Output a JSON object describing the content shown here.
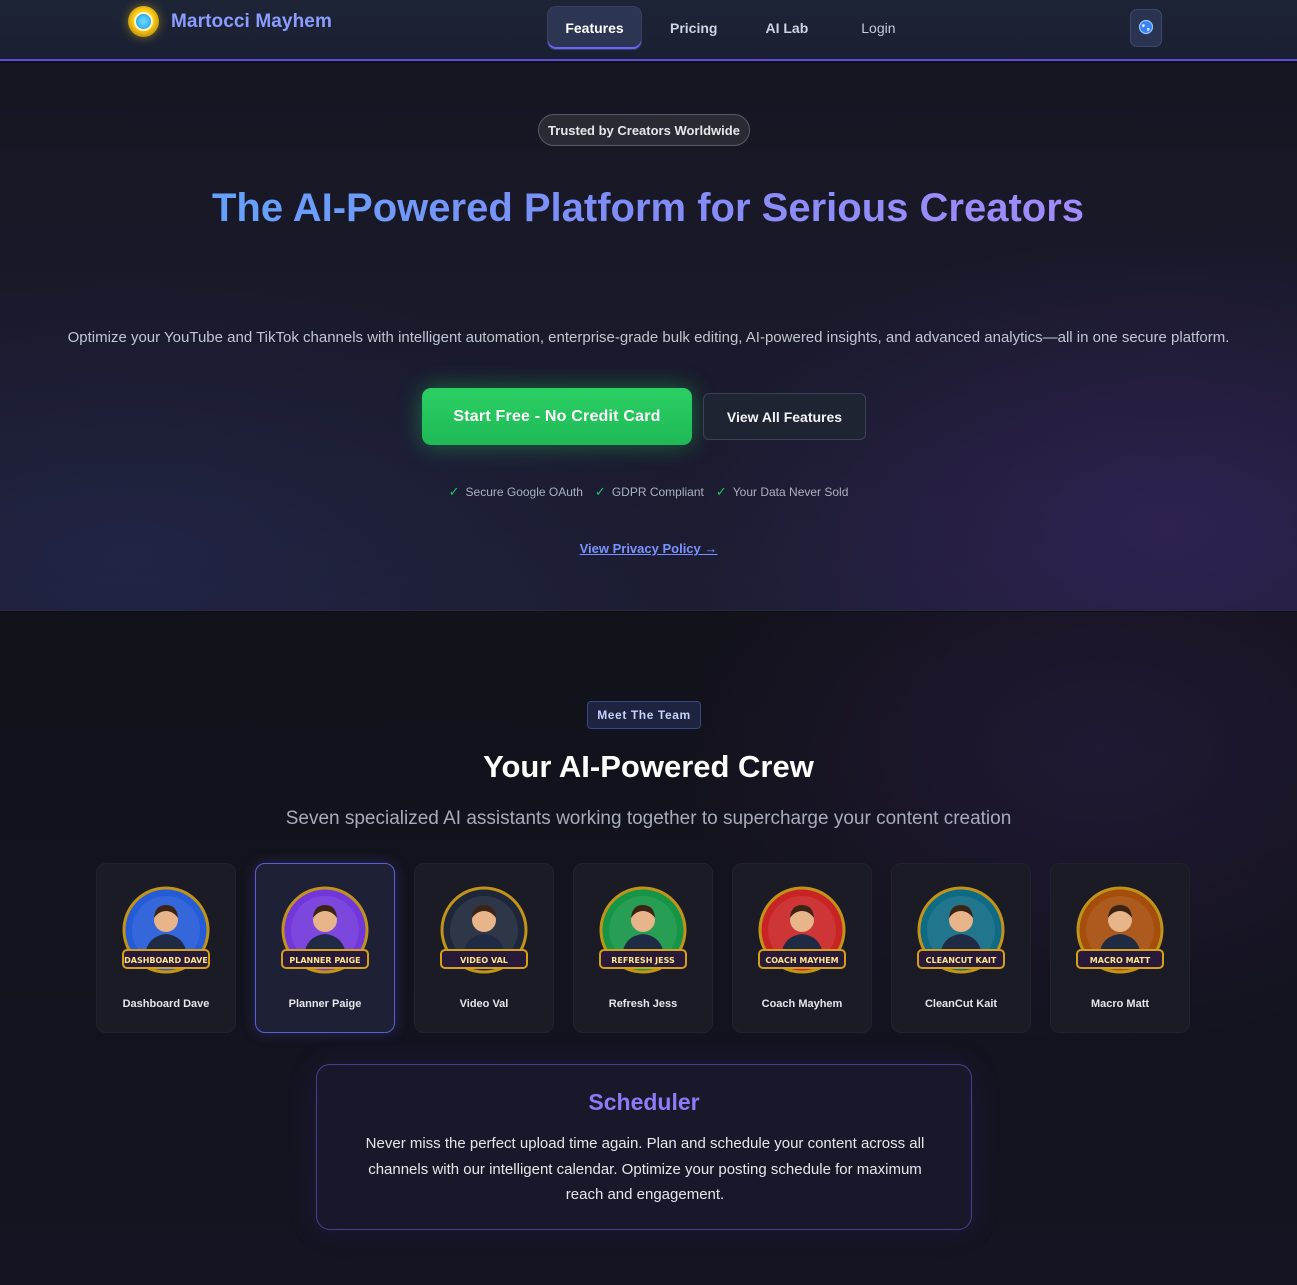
{
  "brand": {
    "name": "Martocci Mayhem",
    "logo_icon": "globe-coin-logo"
  },
  "nav": {
    "links": [
      {
        "label": "Features",
        "active": true
      },
      {
        "label": "Pricing"
      },
      {
        "label": "AI Lab"
      },
      {
        "label": "Login"
      }
    ],
    "language_icon": "globe-icon"
  },
  "hero": {
    "badge": "Trusted by Creators Worldwide",
    "title": "The AI-Powered Platform for Serious Creators",
    "subtitle": "Optimize your YouTube and TikTok channels with intelligent automation, enterprise-grade bulk editing, AI-powered insights, and advanced analytics—all in one secure platform.",
    "cta_primary": "Start Free - No Credit Card",
    "cta_secondary": "View All Features",
    "trust_items": [
      "Secure Google OAuth",
      "GDPR Compliant",
      "Your Data Never Sold"
    ],
    "check_glyph": "✓",
    "privacy_link": "View Privacy Policy →"
  },
  "team": {
    "badge": "Meet The Team",
    "title": "Your AI-Powered Crew",
    "subtitle": "Seven specialized AI assistants working together to supercharge your content creation",
    "members": [
      {
        "name": "Dashboard Dave",
        "badge_text": "DASHBOARD DAVE",
        "color": "#2563eb"
      },
      {
        "name": "Planner Paige",
        "badge_text": "PLANNER PAIGE",
        "color": "#7c3aed",
        "selected": true
      },
      {
        "name": "Video Val",
        "badge_text": "VIDEO VAL",
        "color": "#1e293b"
      },
      {
        "name": "Refresh Jess",
        "badge_text": "REFRESH JESS",
        "color": "#16a34a"
      },
      {
        "name": "Coach Mayhem",
        "badge_text": "COACH MAYHEM",
        "color": "#dc2626"
      },
      {
        "name": "CleanCut Kait",
        "badge_text": "CLEANCUT KAIT",
        "color": "#0e7490"
      },
      {
        "name": "Macro Matt",
        "badge_text": "MACRO MATT",
        "color": "#b45309"
      }
    ],
    "feature": {
      "title": "Scheduler",
      "description": "Never miss the perfect upload time again. Plan and schedule your content across all channels with our intelligent calendar. Optimize your posting schedule for maximum reach and engagement."
    }
  }
}
